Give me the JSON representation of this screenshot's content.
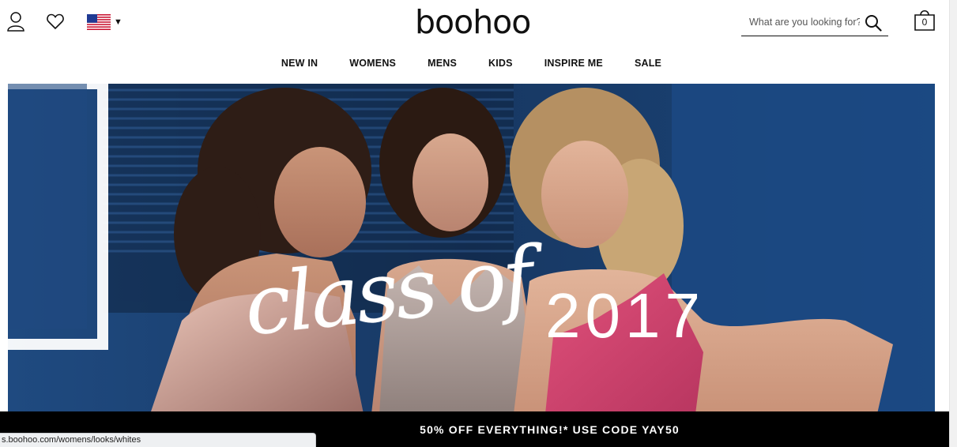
{
  "header": {
    "logo_text": "boohoo",
    "search_placeholder": "What are you looking for?",
    "bag_count": "0",
    "country_flag": "us-flag-icon"
  },
  "nav": {
    "items": [
      {
        "label": "NEW IN"
      },
      {
        "label": "WOMENS"
      },
      {
        "label": "MENS"
      },
      {
        "label": "KIDS"
      },
      {
        "label": "INSPIRE ME"
      },
      {
        "label": "SALE"
      }
    ]
  },
  "hero": {
    "script_text": "class of",
    "year_text": "2017"
  },
  "promo": {
    "text": "50% OFF EVERYTHING!* USE CODE YAY50"
  },
  "status_bar": {
    "url": "s.boohoo.com/womens/looks/whites"
  },
  "colors": {
    "promo_bg": "#000000",
    "hero_bg": "#1c3f6e",
    "text": "#111111"
  }
}
